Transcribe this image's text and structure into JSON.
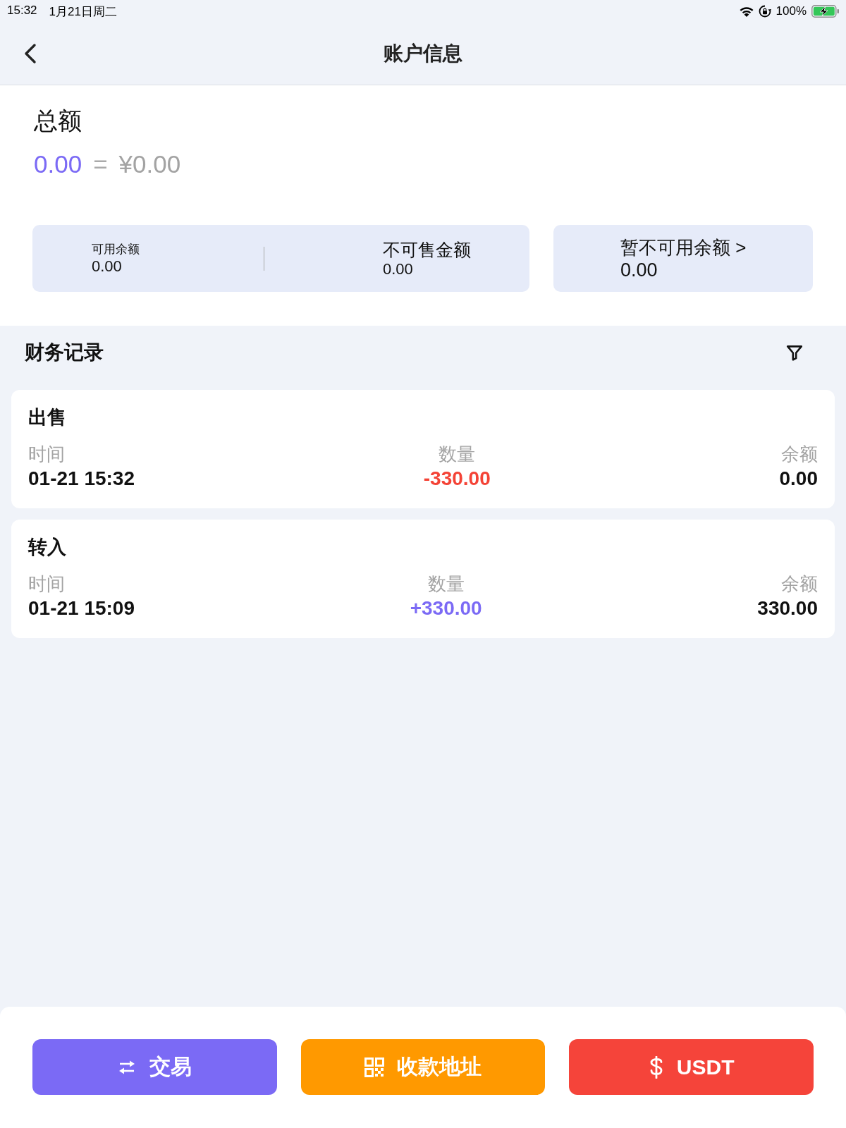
{
  "status_bar": {
    "time": "15:32",
    "date": "1月21日周二",
    "battery": "100%"
  },
  "header": {
    "title": "账户信息"
  },
  "total": {
    "label": "总额",
    "amount": "0.00",
    "equals": "=",
    "fiat_amount": "¥0.00"
  },
  "balance_cards": [
    {
      "kind": "split",
      "items": [
        {
          "kind": "small",
          "label": "可用余额",
          "value": "0.00"
        },
        {
          "kind": "medium",
          "label": "不可售金额",
          "value": "0.00"
        }
      ]
    },
    {
      "kind": "single",
      "items": [
        {
          "kind": "large",
          "label": "暂不可用余额 >",
          "value": "0.00"
        }
      ]
    }
  ],
  "records_section": {
    "title": "财务记录"
  },
  "records": [
    {
      "type": "出售",
      "time_label": "时间",
      "time": "01-21 15:32",
      "amount_label": "数量",
      "amount": "-330.00",
      "color": "#f44336",
      "balance_label": "余额",
      "balance": "0.00"
    },
    {
      "type": "转入",
      "time_label": "时间",
      "time": "01-21 15:09",
      "amount_label": "数量",
      "amount": "+330.00",
      "color": "#7b6af5",
      "balance_label": "余额",
      "balance": "330.00"
    }
  ],
  "buttons": [
    {
      "kind": "swap",
      "label": "交易",
      "color": "#7b6af5"
    },
    {
      "kind": "qr",
      "label": "收款地址",
      "color": "#ff9900"
    },
    {
      "kind": "dollar",
      "label": "USDT",
      "color": "#f5443a"
    }
  ]
}
